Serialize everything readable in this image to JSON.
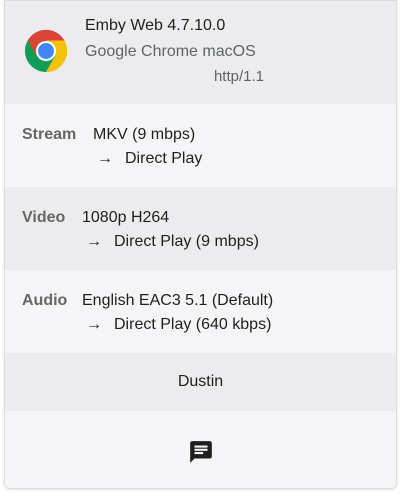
{
  "colors": {
    "accent": "#4caf50",
    "chrome_red": "#db4437",
    "chrome_yellow": "#f4c20d",
    "chrome_green": "#0f9d58",
    "chrome_blue": "#4285f4"
  },
  "header": {
    "app": "Emby Web 4.7.10.0",
    "device": "Google Chrome macOS",
    "protocol": "http/1.1",
    "logo_icon": "chrome-logo"
  },
  "stream": {
    "label": "Stream",
    "value": "MKV (9 mbps)",
    "arrow": "→",
    "method": "Direct Play"
  },
  "video": {
    "label": "Video",
    "value": "1080p H264",
    "arrow": "→",
    "method": "Direct Play (9 mbps)"
  },
  "audio": {
    "label": "Audio",
    "value": "English EAC3 5.1 (Default)",
    "arrow": "→",
    "method": "Direct Play (640 kbps)"
  },
  "user": {
    "name": "Dustin"
  },
  "actions": {
    "message_icon": "message-icon"
  }
}
